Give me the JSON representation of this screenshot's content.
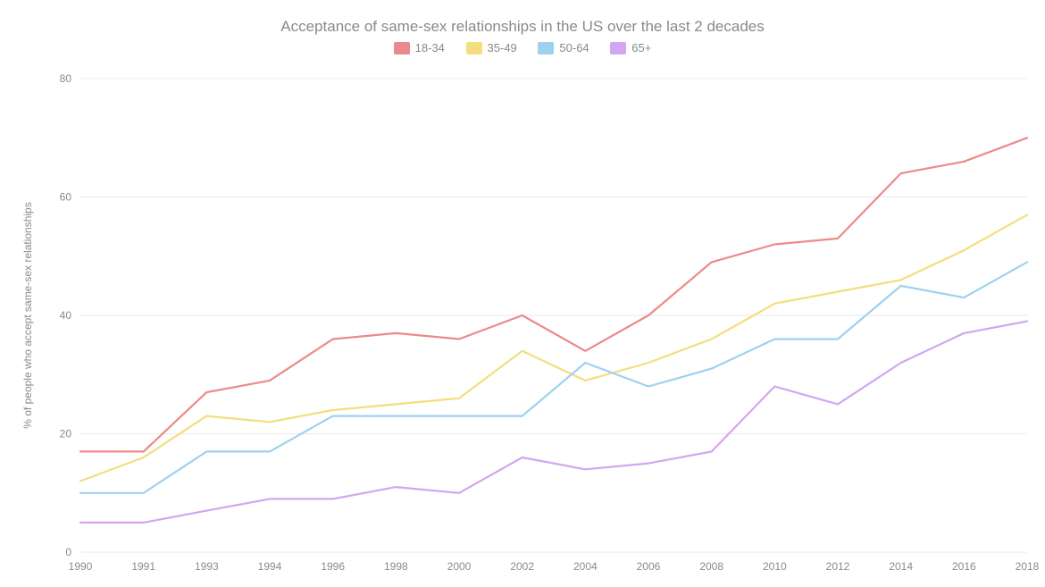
{
  "chart_data": {
    "type": "line",
    "title": "Acceptance of same-sex relationships in the US over the last 2 decades",
    "ylabel": "% of people who accept same-sex relationships",
    "xlabel": "",
    "ylim": [
      0,
      80
    ],
    "y_ticks": [
      0,
      20,
      40,
      60,
      80
    ],
    "categories": [
      1990,
      1991,
      1993,
      1994,
      1996,
      1998,
      2000,
      2002,
      2004,
      2006,
      2008,
      2010,
      2012,
      2014,
      2016,
      2018
    ],
    "series": [
      {
        "name": "18-34",
        "color": "#ec8a89",
        "values": [
          17,
          17,
          27,
          29,
          36,
          37,
          36,
          40,
          34,
          40,
          49,
          52,
          53,
          64,
          66,
          70
        ]
      },
      {
        "name": "35-49",
        "color": "#f3de7d",
        "values": [
          12,
          16,
          23,
          22,
          24,
          25,
          26,
          34,
          29,
          32,
          36,
          42,
          44,
          46,
          51,
          57
        ]
      },
      {
        "name": "50-64",
        "color": "#9ed1ef",
        "values": [
          10,
          10,
          17,
          17,
          23,
          23,
          23,
          23,
          32,
          28,
          31,
          36,
          36,
          45,
          43,
          49
        ]
      },
      {
        "name": "65+",
        "color": "#d2a6f0",
        "values": [
          5,
          5,
          7,
          9,
          9,
          11,
          10,
          16,
          14,
          15,
          17,
          28,
          25,
          32,
          37,
          39
        ]
      }
    ]
  }
}
